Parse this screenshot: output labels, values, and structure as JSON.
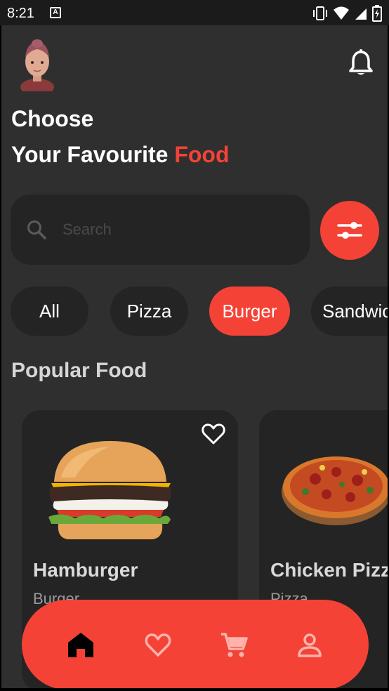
{
  "status_bar": {
    "time": "8:21",
    "icons": [
      "vibrate-icon",
      "wifi-icon",
      "signal-icon",
      "battery-charging-icon"
    ]
  },
  "header": {
    "avatar": "avatar-image",
    "notification_icon": "bell-icon",
    "heading_line1": "Choose",
    "heading_line2_prefix": "Your Favourite ",
    "heading_line2_highlight": "Food"
  },
  "search": {
    "placeholder": "Search",
    "value": "",
    "filter_icon": "sliders-icon"
  },
  "categories": [
    {
      "label": "All",
      "active": false
    },
    {
      "label": "Pizza",
      "active": false
    },
    {
      "label": "Burger",
      "active": true
    },
    {
      "label": "Sandwich",
      "active": false
    }
  ],
  "popular": {
    "title": "Popular Food",
    "items": [
      {
        "name": "Hamburger",
        "category": "Burger",
        "favorite_icon": "heart-outline-icon"
      },
      {
        "name": "Chicken Pizza",
        "category": "Pizza",
        "favorite_icon": "heart-outline-icon"
      }
    ]
  },
  "bottom_nav": {
    "items": [
      {
        "icon": "home-icon",
        "active": true
      },
      {
        "icon": "heart-icon",
        "active": false
      },
      {
        "icon": "cart-icon",
        "active": false
      },
      {
        "icon": "profile-icon",
        "active": false
      }
    ]
  },
  "colors": {
    "accent": "#f44336",
    "background": "#2f2f2f",
    "surface": "#242424"
  }
}
